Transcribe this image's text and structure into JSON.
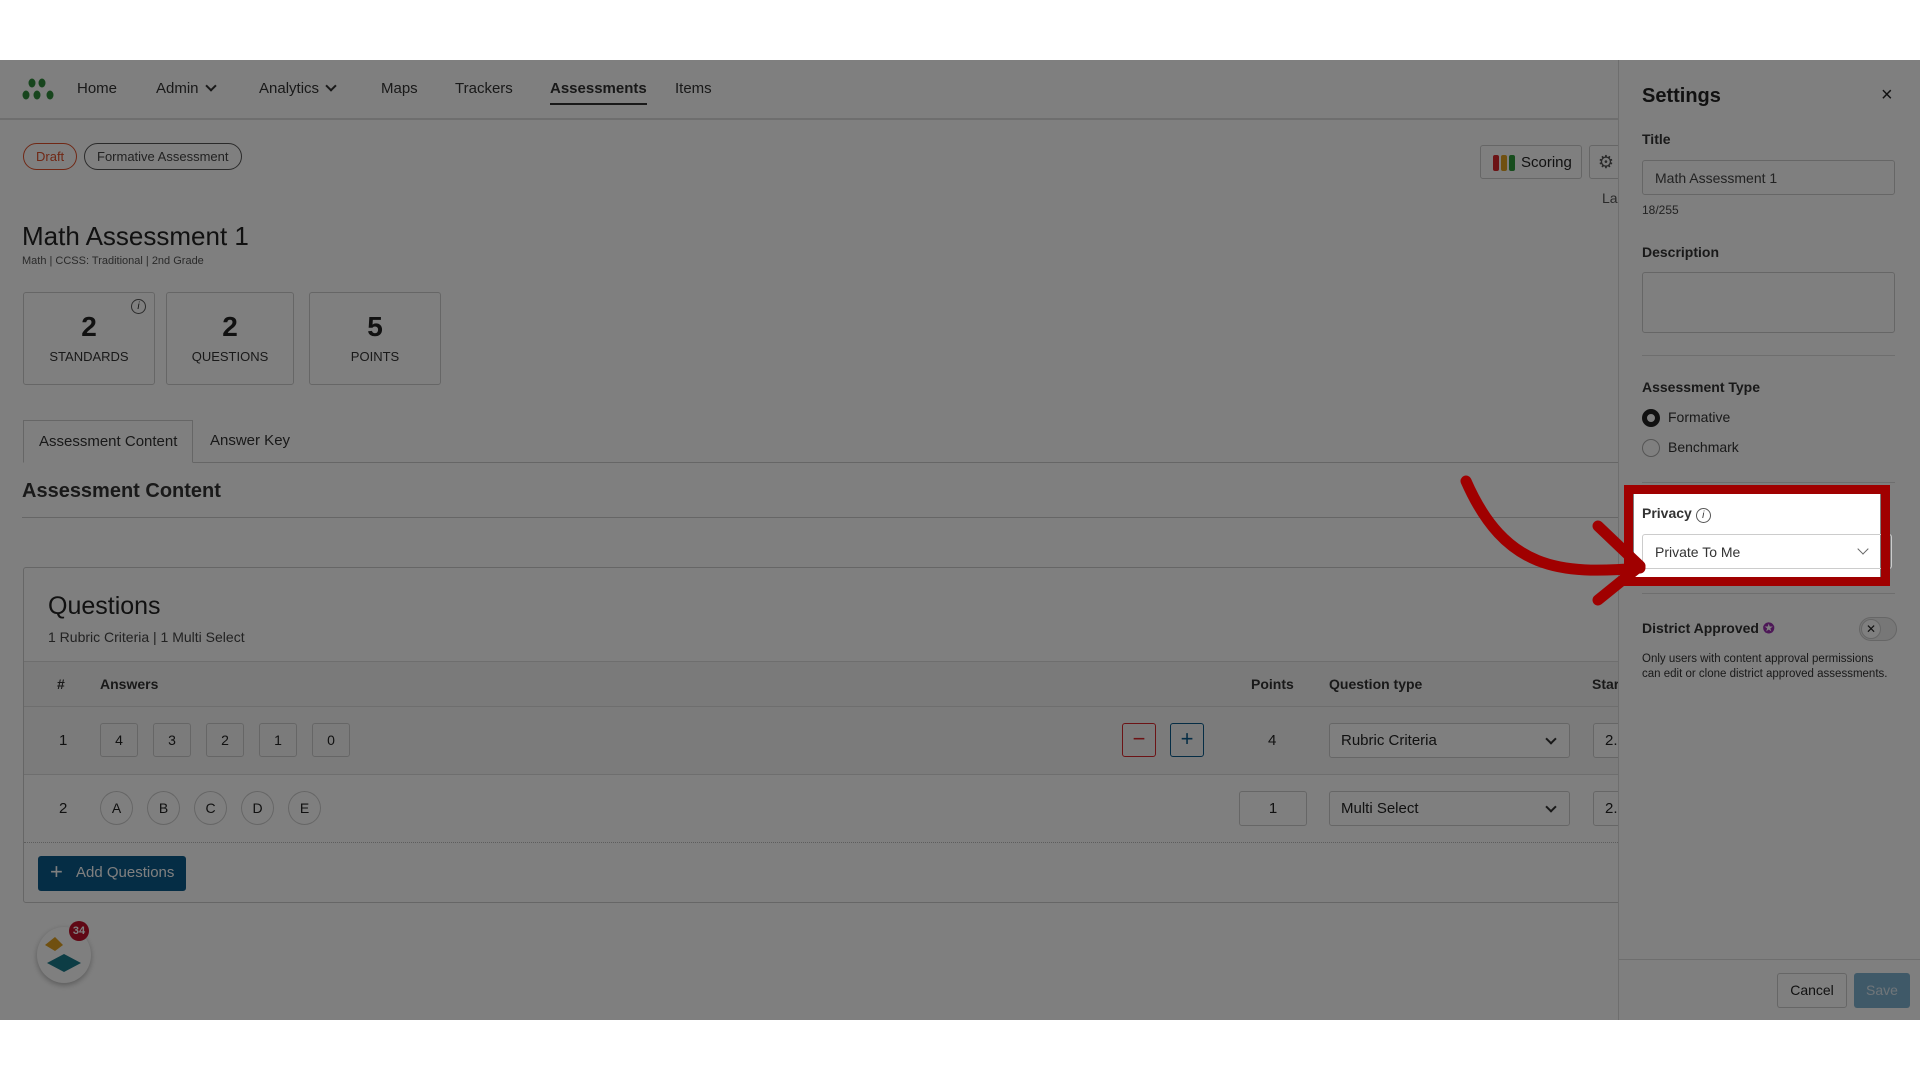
{
  "nav": {
    "items": [
      {
        "label": "Home"
      },
      {
        "label": "Admin",
        "dropdown": true
      },
      {
        "label": "Analytics",
        "dropdown": true
      },
      {
        "label": "Maps"
      },
      {
        "label": "Trackers"
      },
      {
        "label": "Assessments",
        "active": true
      },
      {
        "label": "Items"
      }
    ]
  },
  "badges": {
    "status": "Draft",
    "type": "Formative Assessment"
  },
  "assessment": {
    "title": "Math Assessment 1",
    "meta": "Math | CCSS: Traditional | 2nd Grade"
  },
  "stats": [
    {
      "value": "2",
      "label": "STANDARDS"
    },
    {
      "value": "2",
      "label": "QUESTIONS"
    },
    {
      "value": "5",
      "label": "POINTS"
    }
  ],
  "toolbar": {
    "scoring": "Scoring",
    "last_cut": "La"
  },
  "tabs": [
    {
      "label": "Assessment Content",
      "active": true
    },
    {
      "label": "Answer Key"
    }
  ],
  "section_title": "Assessment Content",
  "questions": {
    "title": "Questions",
    "summary": "1 Rubric Criteria | 1 Multi Select",
    "headers": {
      "num": "#",
      "answers": "Answers",
      "points": "Points",
      "type": "Question type",
      "standards": "Star"
    },
    "rows": [
      {
        "num": "1",
        "answers": [
          "4",
          "3",
          "2",
          "1",
          "0"
        ],
        "points": "4",
        "type": "Rubric Criteria",
        "std": "2."
      },
      {
        "num": "2",
        "answers": [
          "A",
          "B",
          "C",
          "D",
          "E"
        ],
        "points": "1",
        "type": "Multi Select",
        "std": "2."
      }
    ],
    "add_label": "Add Questions"
  },
  "float_badge": "34",
  "settings": {
    "title": "Settings",
    "title_label": "Title",
    "title_value": "Math Assessment 1",
    "title_count": "18/255",
    "description_label": "Description",
    "description_value": "",
    "type_label": "Assessment Type",
    "type_options": [
      "Formative",
      "Benchmark"
    ],
    "type_selected": "Formative",
    "privacy_label": "Privacy",
    "privacy_value": "Private To Me",
    "district_label": "District Approved",
    "district_on": false,
    "district_help": "Only users with content approval permissions can edit or clone district approved assessments.",
    "cancel": "Cancel",
    "save": "Save"
  },
  "colors": {
    "highlight": "#a00000",
    "primary": "#0b5a8a",
    "draft": "#e0502a",
    "logo": "#2e8b3a"
  }
}
